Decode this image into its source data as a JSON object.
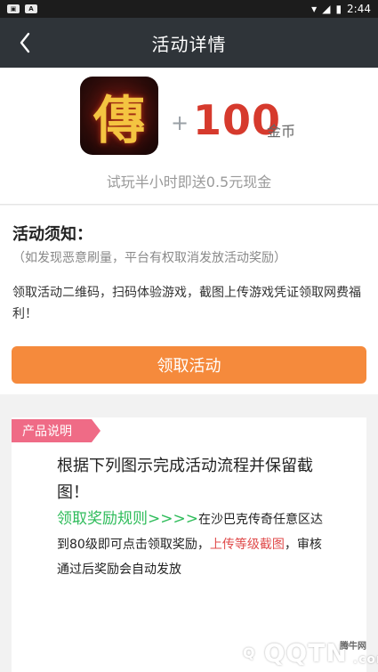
{
  "status_bar": {
    "left_icons": [
      "status-app-icon",
      "status-a-icon"
    ],
    "time": "2:44"
  },
  "nav": {
    "back_icon": "chevron-left-icon",
    "title": "活动详情"
  },
  "reward": {
    "game_icon_text": "傳",
    "game_icon_small": "传奇",
    "plus": "+",
    "amount": "100",
    "unit": "金币",
    "subtitle": "试玩半小时即送0.5元现金"
  },
  "notice": {
    "title": "活动须知：",
    "warning": "（如发现恶意刷量，平台有权取消发放活动奖励）",
    "description": "领取活动二维码，扫码体验游戏，截图上传游戏凭证领取网费福利！",
    "button_label": "领取活动"
  },
  "product": {
    "tag": "产品说明",
    "paragraph1": "根据下列图示完成活动流程并保留截图！",
    "rule_link": "领取奖励规则>>>>",
    "paragraph2_a": "在沙巴克传奇任意区达到80级即可点击领取奖励，",
    "paragraph2_red": "上传等级截图",
    "paragraph2_b": "，审核通过后奖励会自动发放"
  },
  "watermark": {
    "text": "QQTN",
    "small": "腾牛网",
    "domain": ".com"
  },
  "colors": {
    "nav_bg": "#2f3439",
    "accent": "#d63a2d",
    "button": "#f58a3c",
    "tag": "#ef6b86",
    "green": "#2ebc5a",
    "red": "#e04b4b"
  }
}
